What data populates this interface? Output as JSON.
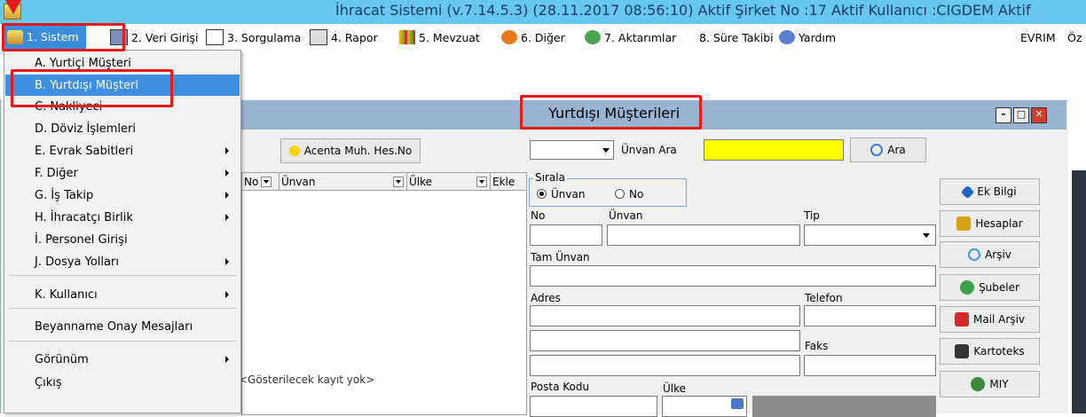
{
  "app": {
    "title": "İhracat Sistemi (v.7.14.5.3) (28.11.2017 08:56:10) Aktif Şirket No :17 Aktif Kullanıcı :CIGDEM Aktif"
  },
  "menubar": {
    "items": [
      {
        "label": "1. Sistem",
        "icon": "app-icon"
      },
      {
        "label": "2. Veri Girişi",
        "icon": "notebook-icon"
      },
      {
        "label": "3. Sorgulama",
        "icon": "query-icon"
      },
      {
        "label": "4. Rapor",
        "icon": "printer-icon"
      },
      {
        "label": "5. Mevzuat",
        "icon": "books-icon"
      },
      {
        "label": "6. Diğer",
        "icon": "puzzle-icon"
      },
      {
        "label": "7. Aktarımlar",
        "icon": "transfer-icon"
      },
      {
        "label": "8. Süre Takibi",
        "icon": ""
      },
      {
        "label": "Yardım",
        "icon": "help-icon"
      },
      {
        "label": "EVRIM",
        "icon": ""
      },
      {
        "label": "Öz",
        "icon": ""
      }
    ]
  },
  "dropdown": {
    "items": [
      {
        "label": "A.  Yurtiçi Müşteri",
        "submenu": false
      },
      {
        "label": "B.  Yurtdışı Müşteri",
        "submenu": false,
        "selected": true
      },
      {
        "label": "C.  Nakliyeci",
        "submenu": false
      },
      {
        "label": "D.  Döviz İşlemleri",
        "submenu": false
      },
      {
        "label": "E.  Evrak Sabitleri",
        "submenu": true
      },
      {
        "label": "F.  Diğer",
        "submenu": true
      },
      {
        "label": "G.  İş Takip",
        "submenu": true
      },
      {
        "label": "H.  İhracatçı Birlik",
        "submenu": true
      },
      {
        "label": "İ.  Personel Girişi",
        "submenu": false
      },
      {
        "label": "J.  Dosya Yolları",
        "submenu": true
      },
      {
        "label": "K.  Kullanıcı",
        "submenu": true
      },
      {
        "label": "Beyanname Onay Mesajları",
        "submenu": false
      },
      {
        "label": "Görünüm",
        "submenu": true
      },
      {
        "label": "Çıkış",
        "submenu": false
      }
    ]
  },
  "child": {
    "title": "Yurtdışı Müşterileri",
    "acenta_button": "Acenta Muh. Hes.No",
    "unvan_ara_label": "Ünvan Ara",
    "search_value": "",
    "ara_button": "Ara",
    "grid": {
      "columns": [
        "No",
        "Ünvan",
        "Ülke",
        "Ekle"
      ],
      "empty_text": "<Gösterilecek kayıt yok>"
    },
    "sort": {
      "group_label": "Sırala",
      "options": [
        {
          "label": "Ünvan",
          "checked": true
        },
        {
          "label": "No",
          "checked": false
        }
      ]
    },
    "form": {
      "no_label": "No",
      "unvan_label": "Ünvan",
      "tip_label": "Tip",
      "tam_unvan_label": "Tam Ünvan",
      "adres_label": "Adres",
      "telefon_label": "Telefon",
      "faks_label": "Faks",
      "posta_kodu_label": "Posta Kodu",
      "ulke_label": "Ülke"
    },
    "side_buttons": [
      {
        "label": "Ek Bilgi",
        "icon": "info-icon",
        "color": "#1f66c9"
      },
      {
        "label": "Hesaplar",
        "icon": "accounts-icon",
        "color": "#d8a218"
      },
      {
        "label": "Arşiv",
        "icon": "search-icon",
        "color": "#4b9bd8"
      },
      {
        "label": "Şubeler",
        "icon": "branches-icon",
        "color": "#3aa34a"
      },
      {
        "label": "Mail Arşiv",
        "icon": "mail-icon",
        "color": "#d12a2a"
      },
      {
        "label": "Kartoteks",
        "icon": "card-icon",
        "color": "#333333"
      },
      {
        "label": "MIY",
        "icon": "globe-icon",
        "color": "#3a8a3a"
      }
    ],
    "window_buttons": {
      "minimize": "–",
      "maximize": "□",
      "close": "✕"
    }
  },
  "colors": {
    "titlebar": "#68c7ec",
    "menu_selected": "#3b8ddb",
    "highlight": "#e51b1b",
    "search_field": "#ffff00",
    "child_title": "#99b4d1"
  }
}
